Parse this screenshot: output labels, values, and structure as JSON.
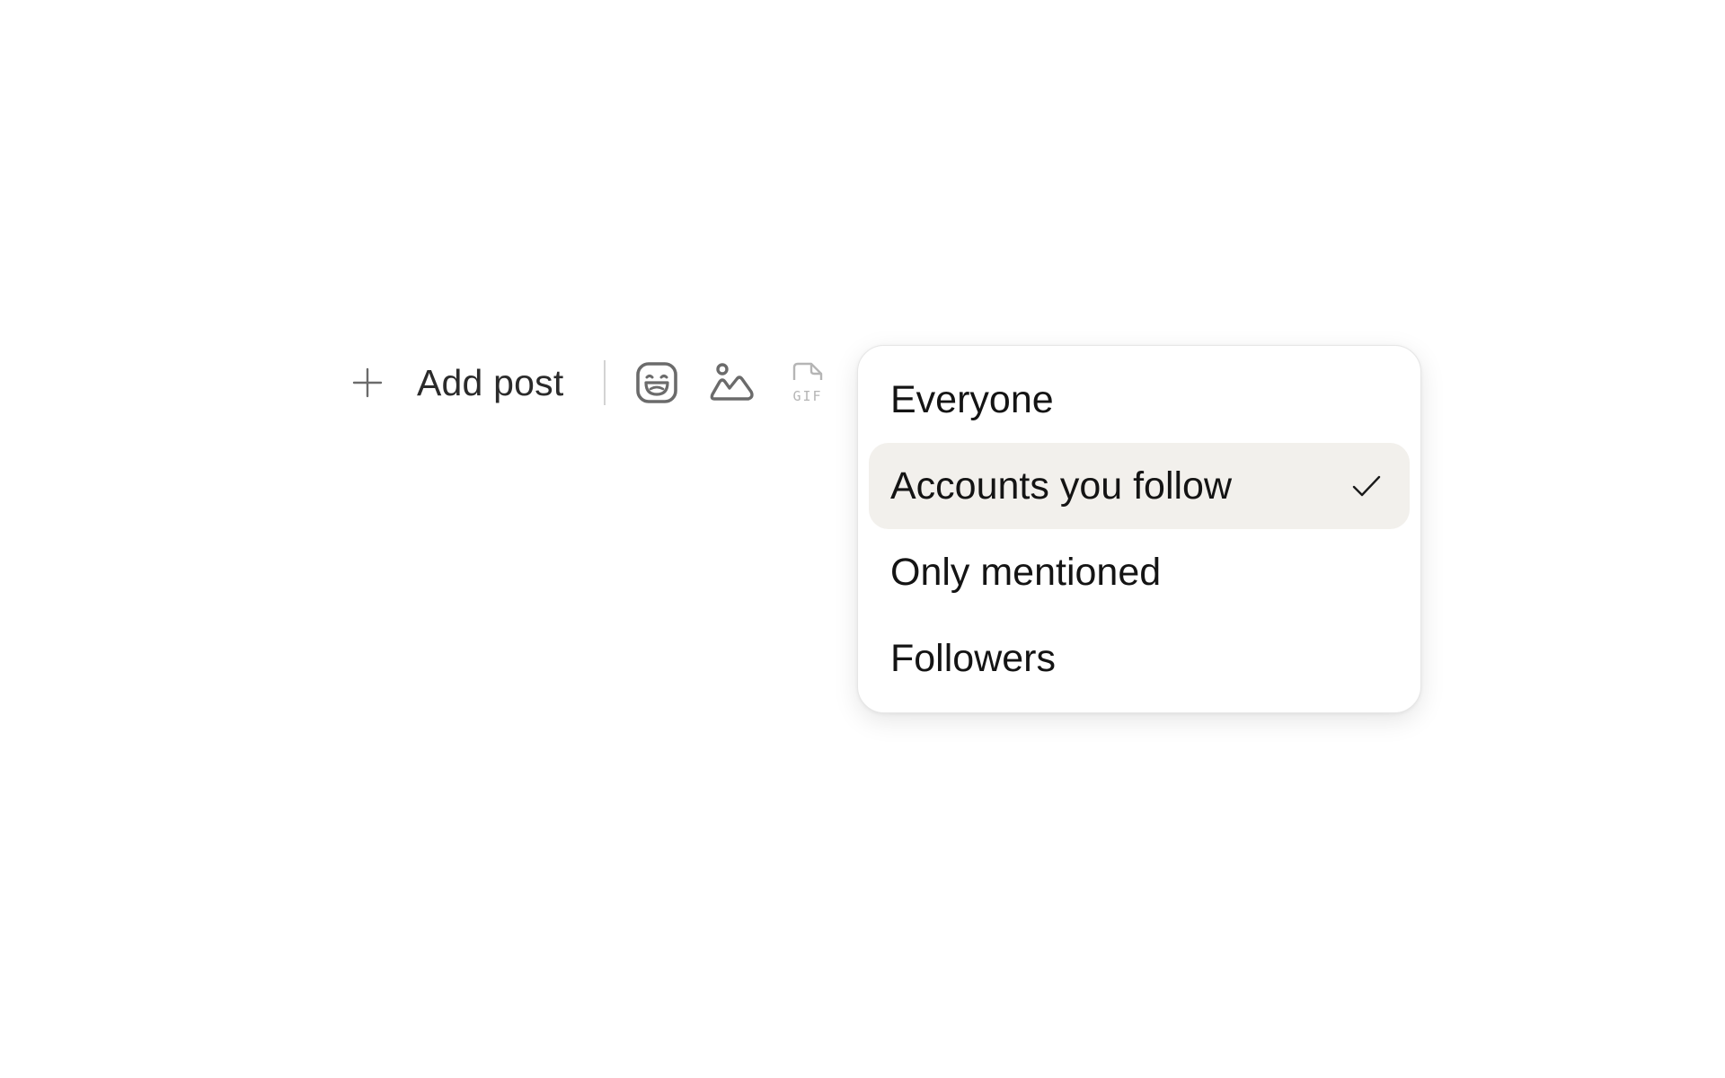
{
  "composer": {
    "add_post_label": "Add post",
    "icons": [
      "plus-icon",
      "emoji-icon",
      "image-icon",
      "gif-icon"
    ],
    "gif_icon_text": "GIF"
  },
  "reply_audience_menu": {
    "items": [
      {
        "label": "Everyone",
        "selected": false
      },
      {
        "label": "Accounts you follow",
        "selected": true
      },
      {
        "label": "Only mentioned",
        "selected": false
      },
      {
        "label": "Followers",
        "selected": false
      }
    ],
    "selected_icon": "check-icon"
  },
  "colors": {
    "selected_item_bg": "#f2f0ec",
    "icon_color": "#6b6b6b",
    "disabled_icon_color": "#b5b5b5",
    "text_color": "#141414"
  }
}
